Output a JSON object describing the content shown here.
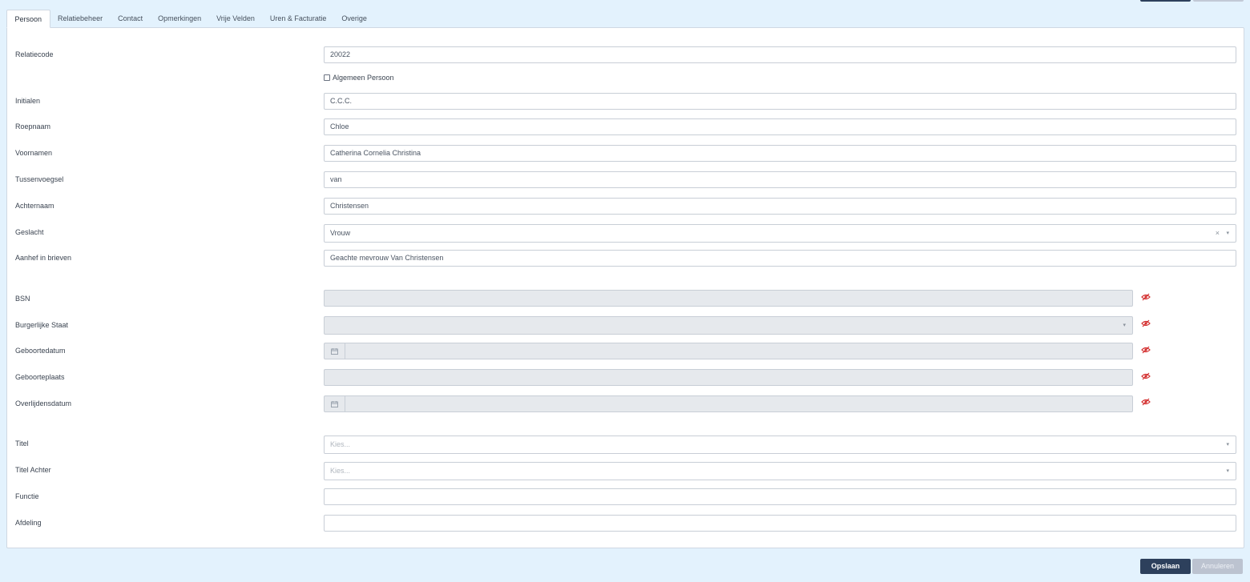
{
  "tabs": [
    {
      "label": "Persoon",
      "active": true
    },
    {
      "label": "Relatiebeheer"
    },
    {
      "label": "Contact"
    },
    {
      "label": "Opmerkingen"
    },
    {
      "label": "Vrije Velden"
    },
    {
      "label": "Uren & Facturatie"
    },
    {
      "label": "Overige"
    }
  ],
  "form": {
    "relatiecode": {
      "label": "Relatiecode",
      "value": "20022"
    },
    "algemeen": {
      "label": "Algemeen Persoon",
      "checked": false
    },
    "initialen": {
      "label": "Initialen",
      "value": "C.C.C."
    },
    "roepnaam": {
      "label": "Roepnaam",
      "value": "Chloe"
    },
    "voornamen": {
      "label": "Voornamen",
      "value": "Catherina Cornelia Christina"
    },
    "tussenvoegsel": {
      "label": "Tussenvoegsel",
      "value": "van"
    },
    "achternaam": {
      "label": "Achternaam",
      "value": "Christensen"
    },
    "geslacht": {
      "label": "Geslacht",
      "value": "Vrouw",
      "clear": "×",
      "caret": "▾"
    },
    "aanhef": {
      "label": "Aanhef in brieven",
      "value": "Geachte mevrouw Van Christensen"
    },
    "bsn": {
      "label": "BSN",
      "value": ""
    },
    "burgerlijke_staat": {
      "label": "Burgerlijke Staat",
      "value": "",
      "caret": "▾"
    },
    "geboortedatum": {
      "label": "Geboortedatum",
      "value": ""
    },
    "geboorteplaats": {
      "label": "Geboorteplaats",
      "value": ""
    },
    "overlijdensdatum": {
      "label": "Overlijdensdatum",
      "value": ""
    },
    "titel": {
      "label": "Titel",
      "placeholder": "Kies...",
      "caret": "▾"
    },
    "titel_achter": {
      "label": "Titel Achter",
      "placeholder": "Kies...",
      "caret": "▾"
    },
    "functie": {
      "label": "Functie",
      "value": ""
    },
    "afdeling": {
      "label": "Afdeling",
      "value": ""
    }
  },
  "buttons": {
    "save": "Opslaan",
    "cancel": "Annuleren"
  },
  "colors": {
    "primary": "#2d405c",
    "background": "#e3f2fd",
    "eye_icon": "#d32f2f"
  }
}
